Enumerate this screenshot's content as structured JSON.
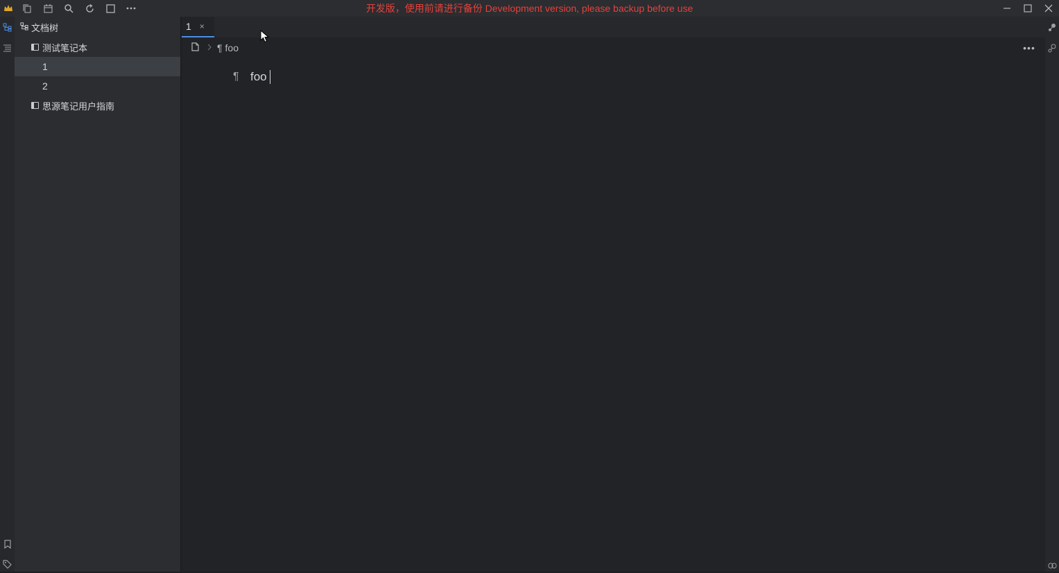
{
  "titlebar": {
    "dev_warning": "开发版，使用前请进行备份 Development version, please backup before use",
    "toolbar_icons": [
      "app-logo-icon",
      "copy-icon",
      "calendar-icon",
      "search-icon",
      "sync-icon",
      "fullscreen-icon",
      "more-icon"
    ],
    "window_controls": [
      "minimize-icon",
      "maximize-icon",
      "close-icon"
    ]
  },
  "tree": {
    "header": "文档树",
    "notebooks": [
      {
        "label": "测试笔记本",
        "docs": [
          "1",
          "2"
        ]
      },
      {
        "label": "思源笔记用户指南",
        "docs": []
      }
    ],
    "selected_doc": "1"
  },
  "editor": {
    "tab_label": "1",
    "tab_close": "×",
    "breadcrumb": {
      "para_mark": "¶",
      "label": "foo"
    },
    "more": "•••",
    "block": {
      "para_mark": "¶",
      "text": "foo"
    }
  },
  "colors": {
    "accent": "#4a8fe7",
    "warning": "#e5413c",
    "logo": "#e1a52e"
  }
}
